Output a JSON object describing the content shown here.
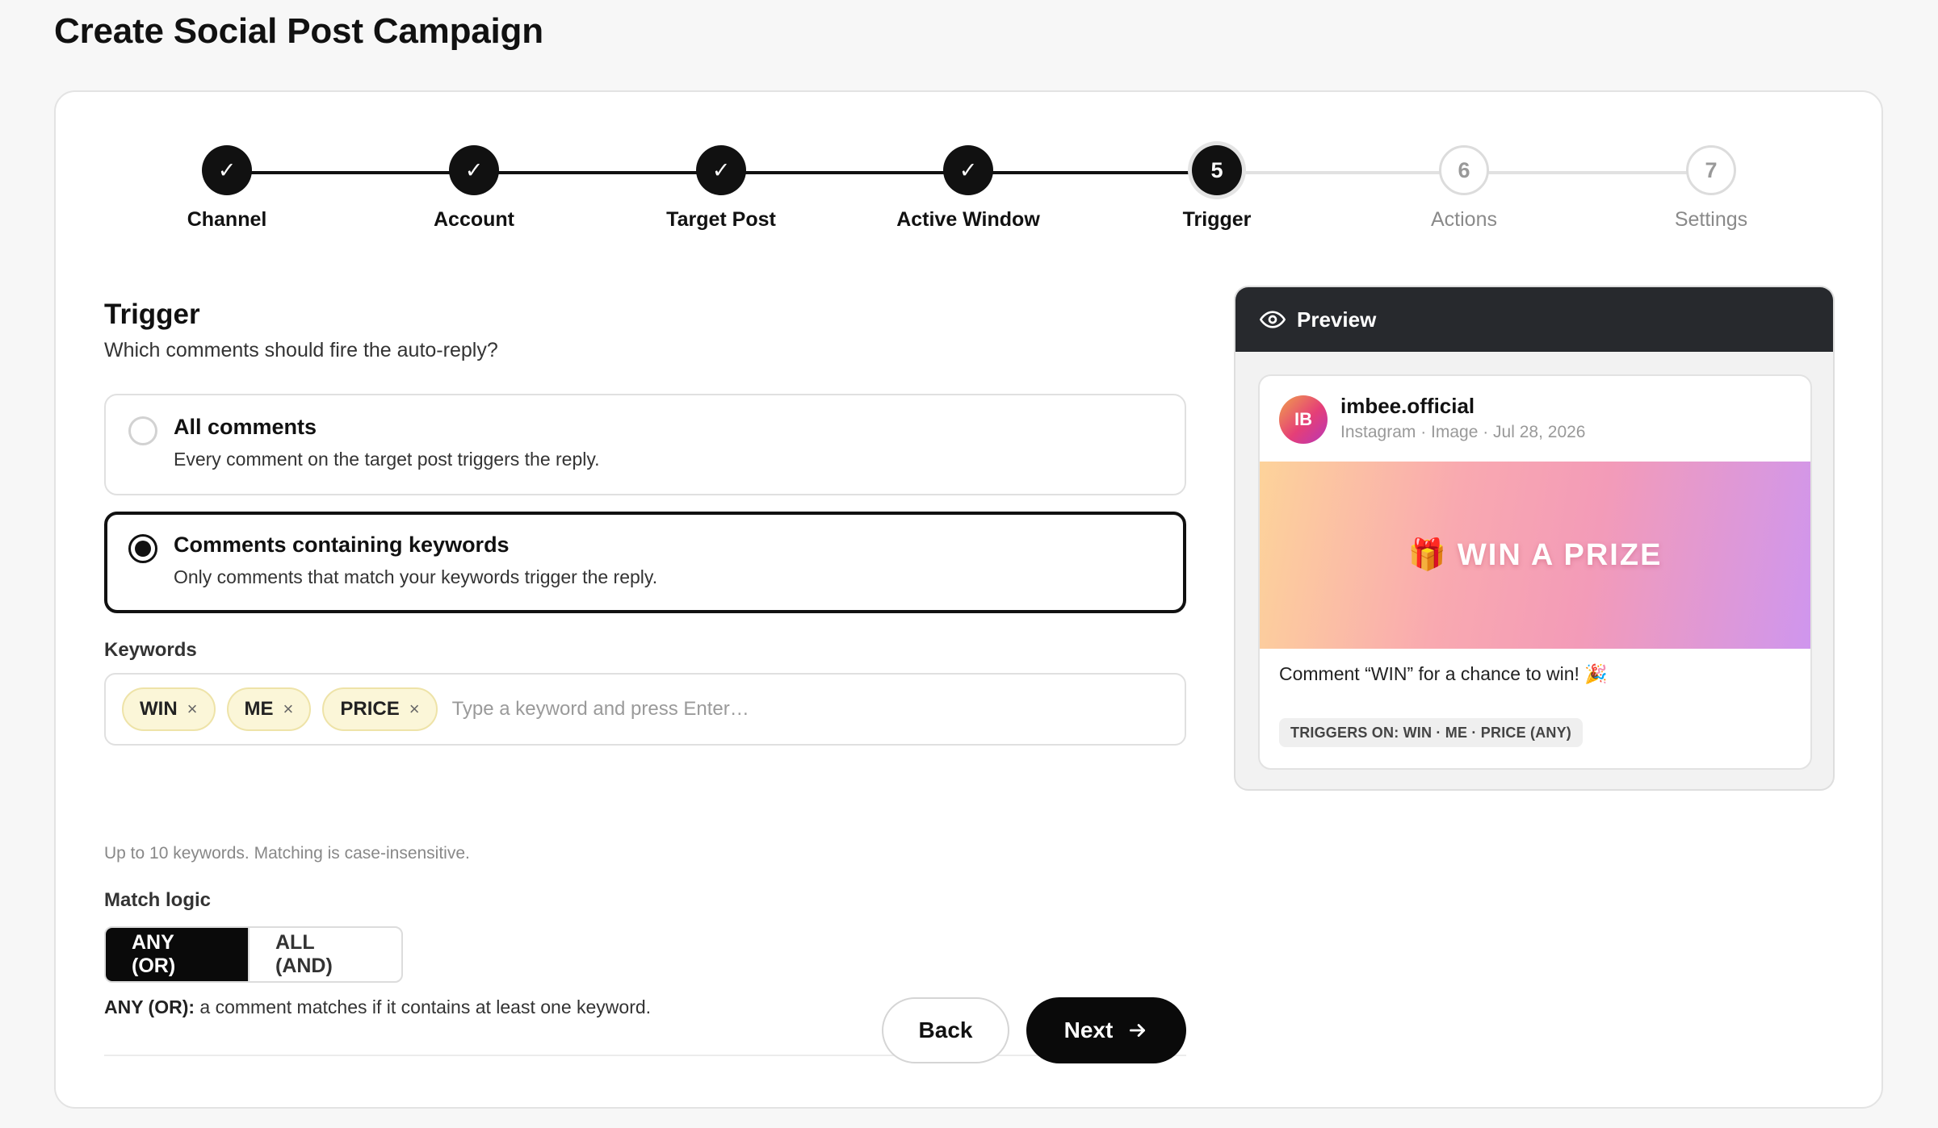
{
  "page": {
    "title": "Create Social Post Campaign"
  },
  "stepper": {
    "steps": [
      {
        "label": "Channel",
        "state": "done",
        "marker": "✓"
      },
      {
        "label": "Account",
        "state": "done",
        "marker": "✓"
      },
      {
        "label": "Target Post",
        "state": "done",
        "marker": "✓"
      },
      {
        "label": "Active Window",
        "state": "done",
        "marker": "✓"
      },
      {
        "label": "Trigger",
        "state": "current",
        "marker": "5"
      },
      {
        "label": "Actions",
        "state": "todo",
        "marker": "6"
      },
      {
        "label": "Settings",
        "state": "todo",
        "marker": "7"
      }
    ]
  },
  "trigger": {
    "title": "Trigger",
    "subtitle": "Which comments should fire the auto-reply?",
    "options": [
      {
        "title": "All comments",
        "desc": "Every comment on the target post triggers the reply.",
        "selected": false
      },
      {
        "title": "Comments containing keywords",
        "desc": "Only comments that match your keywords trigger the reply.",
        "selected": true
      }
    ]
  },
  "keywords": {
    "label": "Keywords",
    "chips": [
      "WIN",
      "ME",
      "PRICE"
    ],
    "remove_glyph": "×",
    "input_value": "",
    "placeholder": "Type a keyword and press Enter…",
    "hint": "Up to 10 keywords. Matching is case-insensitive."
  },
  "match_logic": {
    "label": "Match logic",
    "options": [
      "ANY (OR)",
      "ALL (AND)"
    ],
    "selected": "ANY (OR)",
    "note_strong": "ANY (OR):",
    "note_text": " a comment matches if it contains at least one keyword."
  },
  "buttons": {
    "back": "Back",
    "next": "Next"
  },
  "preview": {
    "title": "Preview",
    "avatar_initials": "IB",
    "account_name": "imbee.official",
    "meta": "Instagram · Image · Jul 28, 2026",
    "image_icon": "🎁",
    "image_text": "WIN A PRIZE",
    "caption": "Comment “WIN” for a chance to win! 🎉",
    "badge": "TRIGGERS ON: WIN · ME · PRICE (ANY)"
  },
  "colors": {
    "primary": "#0a0a0a",
    "chip_bg": "#fbf6d8",
    "preview_header": "#27292d",
    "muted_text": "#8a8a8a"
  }
}
